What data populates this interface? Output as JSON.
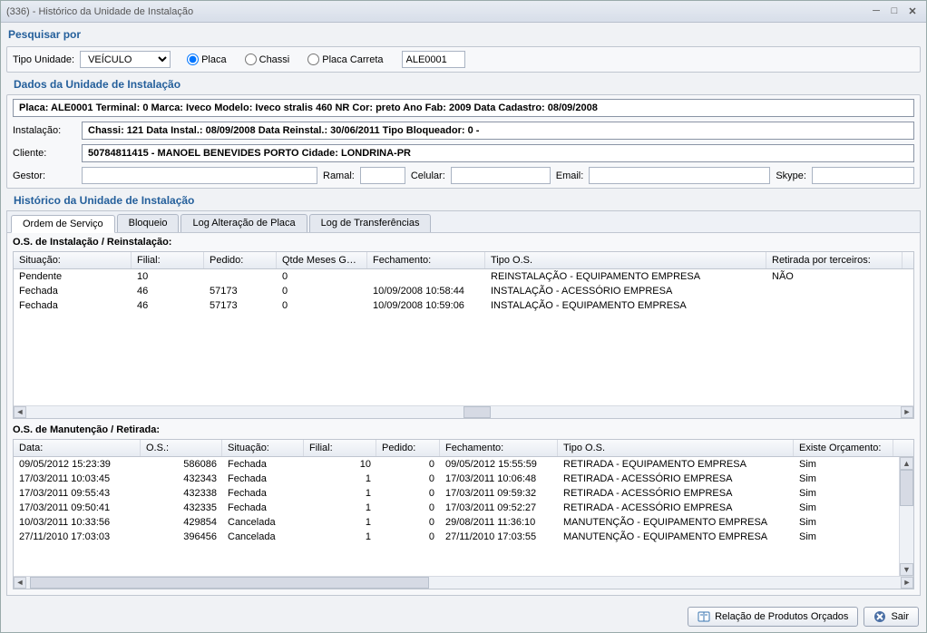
{
  "window": {
    "title": "(336) - Histórico da Unidade de Instalação"
  },
  "search": {
    "section_title": "Pesquisar por",
    "unit_type_label": "Tipo Unidade:",
    "unit_type_value": "VEÍCULO",
    "radio_placa": "Placa",
    "radio_chassi": "Chassi",
    "radio_placa_carreta": "Placa Carreta",
    "search_value": "ALE0001"
  },
  "install_data": {
    "section_title": "Dados da Unidade de Instalação",
    "header_line": "Placa: ALE0001  Terminal: 0  Marca: Iveco  Modelo: Iveco stralis 460 NR  Cor: preto  Ano Fab: 2009  Data Cadastro: 08/09/2008",
    "instalacao_label": "Instalação:",
    "instalacao_value": "Chassi: 121 Data Instal.: 08/09/2008 Data Reinstal.: 30/06/2011 Tipo Bloqueador: 0 -",
    "cliente_label": "Cliente:",
    "cliente_value": "50784811415 - MANOEL BENEVIDES PORTO Cidade: LONDRINA-PR",
    "gestor_label": "Gestor:",
    "ramal_label": "Ramal:",
    "celular_label": "Celular:",
    "email_label": "Email:",
    "skype_label": "Skype:"
  },
  "history": {
    "section_title": "Histórico da Unidade de Instalação",
    "tabs": [
      "Ordem de Serviço",
      "Bloqueio",
      "Log Alteração de Placa",
      "Log de Transferências"
    ],
    "grid1_title": "O.S. de Instalação / Reinstalação:",
    "grid1_headers": [
      "Situação:",
      "Filial:",
      "Pedido:",
      "Qtde Meses Gar...",
      "Fechamento:",
      "Tipo O.S.",
      "Retirada por terceiros:"
    ],
    "grid1_rows": [
      [
        "Pendente",
        "10",
        "",
        "0",
        "",
        "REINSTALAÇÃO - EQUIPAMENTO EMPRESA",
        "NÃO"
      ],
      [
        "Fechada",
        "46",
        "57173",
        "0",
        "10/09/2008 10:58:44",
        "INSTALAÇÃO - ACESSÓRIO EMPRESA",
        ""
      ],
      [
        "Fechada",
        "46",
        "57173",
        "0",
        "10/09/2008 10:59:06",
        "INSTALAÇÃO - EQUIPAMENTO EMPRESA",
        ""
      ]
    ],
    "grid2_title": "O.S. de Manutenção / Retirada:",
    "grid2_headers": [
      "Data:",
      "O.S.:",
      "Situação:",
      "Filial:",
      "Pedido:",
      "Fechamento:",
      "Tipo O.S.",
      "Existe Orçamento:"
    ],
    "grid2_rows": [
      [
        "09/05/2012 15:23:39",
        "586086",
        "Fechada",
        "10",
        "0",
        "09/05/2012 15:55:59",
        "RETIRADA - EQUIPAMENTO EMPRESA",
        "Sim"
      ],
      [
        "17/03/2011 10:03:45",
        "432343",
        "Fechada",
        "1",
        "0",
        "17/03/2011 10:06:48",
        "RETIRADA - ACESSÓRIO EMPRESA",
        "Sim"
      ],
      [
        "17/03/2011 09:55:43",
        "432338",
        "Fechada",
        "1",
        "0",
        "17/03/2011 09:59:32",
        "RETIRADA - ACESSÓRIO EMPRESA",
        "Sim"
      ],
      [
        "17/03/2011 09:50:41",
        "432335",
        "Fechada",
        "1",
        "0",
        "17/03/2011 09:52:27",
        "RETIRADA - ACESSÓRIO EMPRESA",
        "Sim"
      ],
      [
        "10/03/2011 10:33:56",
        "429854",
        "Cancelada",
        "1",
        "0",
        "29/08/2011 11:36:10",
        "MANUTENÇÃO - EQUIPAMENTO EMPRESA",
        "Sim"
      ],
      [
        "27/11/2010 17:03:03",
        "396456",
        "Cancelada",
        "1",
        "0",
        "27/11/2010 17:03:55",
        "MANUTENÇÃO - EQUIPAMENTO EMPRESA",
        "Sim"
      ]
    ]
  },
  "footer": {
    "btn_products": "Relação de Produtos Orçados",
    "btn_exit": "Sair"
  }
}
